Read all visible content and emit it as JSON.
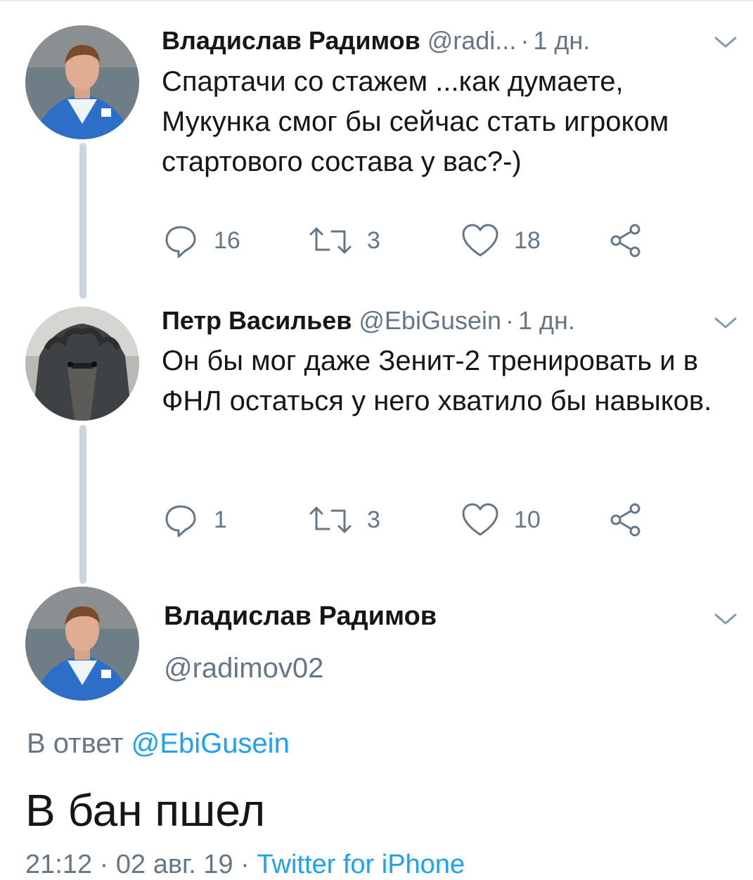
{
  "tweets": [
    {
      "author_name": "Владислав Радимов",
      "handle": "@radi...",
      "time": "1 дн.",
      "text": "Спартачи со стажем ...как думаете, Мукунка смог бы сейчас стать игроком стартового состава у вас?-)",
      "replies": "16",
      "retweets": "3",
      "likes": "18"
    },
    {
      "author_name": "Петр Васильев",
      "handle": "@EbiGusein",
      "time": "1 дн.",
      "text": "Он бы мог даже Зенит-2 тренировать и в ФНЛ остаться у него хватило бы навыков.",
      "replies": "1",
      "retweets": "3",
      "likes": "10"
    }
  ],
  "focused_tweet": {
    "author_name": "Владислав Радимов",
    "handle": "@radimov02",
    "reply_prefix": "В ответ",
    "reply_to": "@EbiGusein",
    "text": "В бан пшел",
    "timestamp": "21:12 · 02 авг. 19 ·",
    "client": "Twitter for iPhone"
  },
  "icons": {
    "reply": "reply-icon",
    "retweet": "retweet-icon",
    "like": "heart-icon",
    "share": "share-icon",
    "menu": "chevron-down-icon"
  },
  "colors": {
    "text": "#14171a",
    "secondary": "#657786",
    "link": "#1da1f2",
    "thread_line": "#ccd6dd"
  }
}
